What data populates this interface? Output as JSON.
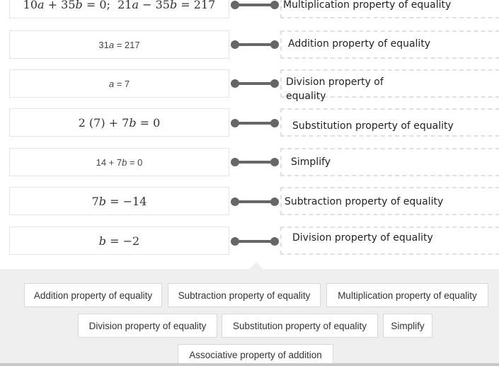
{
  "statements": [
    {
      "html": "10<i>a</i> + 35<i>b</i> = 0;&nbsp; 21<i>a</i> − 35<i>b</i> = 217",
      "style": "math"
    },
    {
      "html": "31<i>a</i> = 217",
      "style": "plain"
    },
    {
      "html": "<i>a</i> = 7",
      "style": "plain"
    },
    {
      "html": "2 (7) + 7<i>b</i> = 0",
      "style": "math"
    },
    {
      "html": "14 + 7<i>b</i> = 0",
      "style": "plain"
    },
    {
      "html": "7<i>b</i> = −14",
      "style": "math"
    },
    {
      "html": "<i>b</i> = −2",
      "style": "math"
    }
  ],
  "answers": [
    "Multiplication property of equality",
    "Addition property of equality",
    "Division property of equality",
    "Substitution property of equality",
    "Simplify",
    "Subtraction property of equality",
    "Division property of equality"
  ],
  "bank": {
    "chips": [
      "Addition property of equality",
      "Subtraction property of equality",
      "Multiplication property of equality",
      "Division property of equality",
      "Substitution property of equality",
      "Simplify",
      "Associative property of addition"
    ]
  }
}
